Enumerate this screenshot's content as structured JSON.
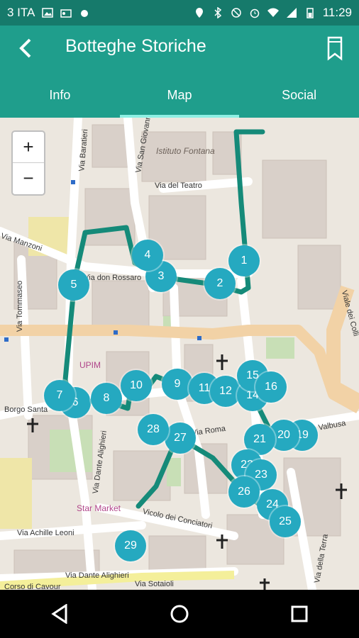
{
  "status_bar": {
    "carrier": "3 ITA",
    "time": "11:29"
  },
  "app_bar": {
    "title": "Botteghe Storiche"
  },
  "tabs": [
    {
      "label": "Info"
    },
    {
      "label": "Map"
    },
    {
      "label": "Social"
    }
  ],
  "map": {
    "zoom_in": "+",
    "zoom_out": "−",
    "labels": [
      {
        "text": "Istituto Fontana"
      },
      {
        "text": "Via del Teatro"
      },
      {
        "text": "Via Manzoni"
      },
      {
        "text": "Via don Rossaro"
      },
      {
        "text": "Via Tommaseo"
      },
      {
        "text": "Via Baratieri"
      },
      {
        "text": "Via San Giovanni"
      },
      {
        "text": "Via Dante Alighieri"
      },
      {
        "text": "Via Roma"
      },
      {
        "text": "Borgo Santa"
      },
      {
        "text": "UPIM"
      },
      {
        "text": "Star Market"
      },
      {
        "text": "Vicolo dei Conciatori"
      },
      {
        "text": "Via Achille Leoni"
      },
      {
        "text": "Via Dante Alighieri"
      },
      {
        "text": "Via Valbusa"
      },
      {
        "text": "Viale dei Colli"
      },
      {
        "text": "Via della Terra"
      },
      {
        "text": "Via Sotaioli"
      },
      {
        "text": "Corso di Cavour"
      }
    ],
    "poi": [
      "1",
      "2",
      "3",
      "4",
      "5",
      "6",
      "7",
      "8",
      "9",
      "10",
      "11",
      "12",
      "14",
      "15",
      "16",
      "19",
      "20",
      "21",
      "22",
      "23",
      "24",
      "25",
      "26",
      "27",
      "28",
      "29"
    ]
  },
  "colors": {
    "primary": "#1f9e8c",
    "status": "#167a6b",
    "marker": "#25a9c0",
    "route": "#158a79",
    "road_main": "#f2d2a6"
  }
}
